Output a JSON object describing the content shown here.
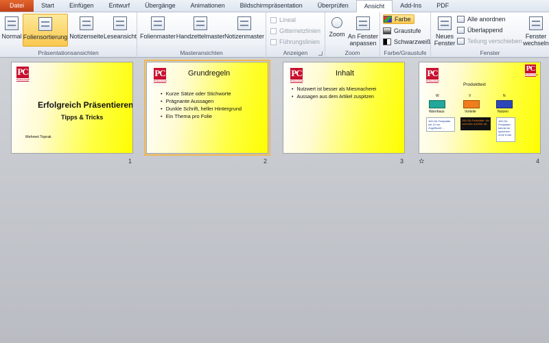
{
  "tabs": [
    {
      "label": "Datei",
      "type": "file"
    },
    {
      "label": "Start"
    },
    {
      "label": "Einfügen"
    },
    {
      "label": "Entwurf"
    },
    {
      "label": "Übergänge"
    },
    {
      "label": "Animationen"
    },
    {
      "label": "Bildschirmpräsentation"
    },
    {
      "label": "Überprüfen"
    },
    {
      "label": "Ansicht",
      "active": true
    },
    {
      "label": "Add-Ins"
    },
    {
      "label": "PDF"
    }
  ],
  "ribbon": {
    "presentation_views": {
      "label": "Präsentationsansichten",
      "normal": "Normal",
      "slide_sorter": "Foliensortierung",
      "notes_page": "Notizenseite",
      "reading_view": "Leseansicht"
    },
    "master_views": {
      "label": "Masteransichten",
      "slide_master": "Folienmaster",
      "handout_master": "Handzettelmaster",
      "notes_master": "Notizenmaster"
    },
    "show": {
      "label": "Anzeigen",
      "ruler": "Lineal",
      "gridlines": "Gitternetzlinien",
      "guides": "Führungslinien"
    },
    "zoom": {
      "label": "Zoom",
      "zoom": "Zoom",
      "fit_line1": "An Fenster",
      "fit_line2": "anpassen"
    },
    "color": {
      "label": "Farbe/Graustufe",
      "color": "Farbe",
      "grayscale": "Graustufe",
      "bw": "Schwarzweiß"
    },
    "window": {
      "label": "Fenster",
      "new_line1": "Neues",
      "new_line2": "Fenster",
      "arrange_all": "Alle anordnen",
      "cascade": "Überlappend",
      "move_split": "Teilung verschieben",
      "switch_line1": "Fenster",
      "switch_line2": "wechseln"
    }
  },
  "slides": [
    {
      "number": "1",
      "title": "Erfolgreich Präsentieren",
      "subtitle": "Tipps & Tricks",
      "author": "Mehmet Toprak"
    },
    {
      "number": "2",
      "title": "Grundregeln",
      "bullets": [
        "Kurze Sätze oder Stichworte",
        "Prägnante Aussagen",
        "Dunkle Schrift, heller Hintergrund",
        "Ein Thema pro Folie"
      ]
    },
    {
      "number": "3",
      "title": "Inhalt",
      "bullets": [
        "Nutzwert ist besser als Miesmacherei",
        "Aussagen aus dem Artikel zuspitzen"
      ]
    },
    {
      "number": "4",
      "title": "Produkttext",
      "boxes": [
        {
          "tag": "W",
          "label": "Warnhaus",
          "color": "#22a79a"
        },
        {
          "tag": "V",
          "label": "Vorteile",
          "color": "#f07d1c"
        },
        {
          "tag": "N",
          "label": "Nutzen",
          "color": "#2d47b8"
        }
      ],
      "notes": [
        "160-Gb-Festplatte: mit 10 ms Zugriffszeit ...",
        "160-Gb-Festplatte: die schneller arbeitet als ...",
        "160-Gb-Festplatte: kannst du speichern ohne Ende ..."
      ]
    }
  ],
  "logo": {
    "text": "PC",
    "sub": "Professionell"
  },
  "colors": {
    "selection": "#f2b64c",
    "file_tab": "#d04c1f",
    "slide_yellow": "#ffff40"
  }
}
